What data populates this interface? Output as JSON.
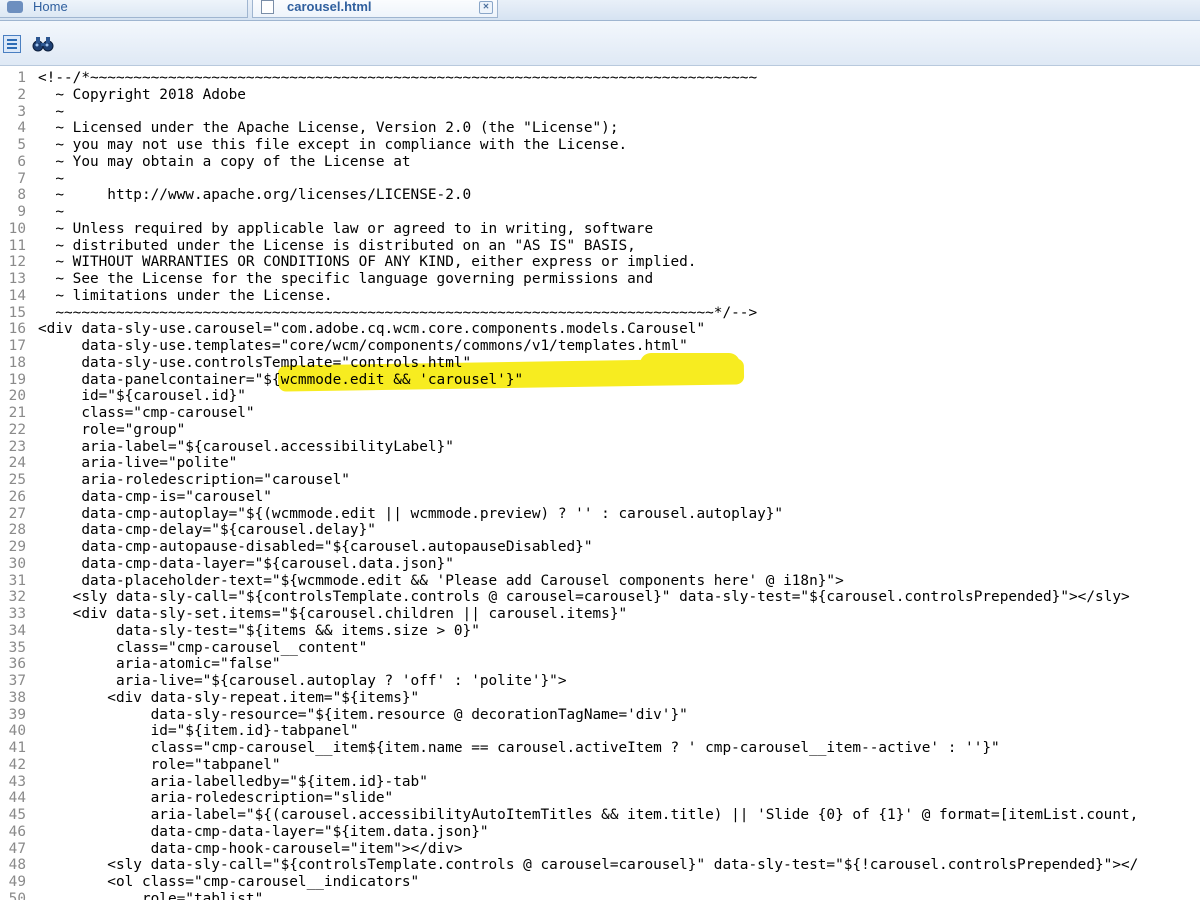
{
  "tabs": [
    {
      "label": "Home",
      "icon": "home-icon"
    },
    {
      "label": "carousel.html",
      "icon": "document-icon"
    }
  ],
  "toolbar": {
    "icons": [
      "outline-icon",
      "find-icon"
    ]
  },
  "highlight_color": "#f7ec20",
  "lines": [
    "<!--/*~~~~~~~~~~~~~~~~~~~~~~~~~~~~~~~~~~~~~~~~~~~~~~~~~~~~~~~~~~~~~~~~~~~~~~~~~~~~~",
    "  ~ Copyright 2018 Adobe",
    "  ~",
    "  ~ Licensed under the Apache License, Version 2.0 (the \"License\");",
    "  ~ you may not use this file except in compliance with the License.",
    "  ~ You may obtain a copy of the License at",
    "  ~",
    "  ~     http://www.apache.org/licenses/LICENSE-2.0",
    "  ~",
    "  ~ Unless required by applicable law or agreed to in writing, software",
    "  ~ distributed under the License is distributed on an \"AS IS\" BASIS,",
    "  ~ WITHOUT WARRANTIES OR CONDITIONS OF ANY KIND, either express or implied.",
    "  ~ See the License for the specific language governing permissions and",
    "  ~ limitations under the License.",
    "  ~~~~~~~~~~~~~~~~~~~~~~~~~~~~~~~~~~~~~~~~~~~~~~~~~~~~~~~~~~~~~~~~~~~~~~~~~~~~*/-->",
    "<div data-sly-use.carousel=\"com.adobe.cq.wcm.core.components.models.Carousel\"",
    "     data-sly-use.templates=\"core/wcm/components/commons/v1/templates.html\"",
    "     data-sly-use.controlsTemplate=\"controls.html\"",
    "     data-panelcontainer=\"${wcmmode.edit && 'carousel'}\"",
    "     id=\"${carousel.id}\"",
    "     class=\"cmp-carousel\"",
    "     role=\"group\"",
    "     aria-label=\"${carousel.accessibilityLabel}\"",
    "     aria-live=\"polite\"",
    "     aria-roledescription=\"carousel\"",
    "     data-cmp-is=\"carousel\"",
    "     data-cmp-autoplay=\"${(wcmmode.edit || wcmmode.preview) ? '' : carousel.autoplay}\"",
    "     data-cmp-delay=\"${carousel.delay}\"",
    "     data-cmp-autopause-disabled=\"${carousel.autopauseDisabled}\"",
    "     data-cmp-data-layer=\"${carousel.data.json}\"",
    "     data-placeholder-text=\"${wcmmode.edit && 'Please add Carousel components here' @ i18n}\">",
    "    <sly data-sly-call=\"${controlsTemplate.controls @ carousel=carousel}\" data-sly-test=\"${carousel.controlsPrepended}\"></sly>",
    "    <div data-sly-set.items=\"${carousel.children || carousel.items}\"",
    "         data-sly-test=\"${items && items.size > 0}\"",
    "         class=\"cmp-carousel__content\"",
    "         aria-atomic=\"false\"",
    "         aria-live=\"${carousel.autoplay ? 'off' : 'polite'}\">",
    "        <div data-sly-repeat.item=\"${items}\"",
    "             data-sly-resource=\"${item.resource @ decorationTagName='div'}\"",
    "             id=\"${item.id}-tabpanel\"",
    "             class=\"cmp-carousel__item${item.name == carousel.activeItem ? ' cmp-carousel__item--active' : ''}\"",
    "             role=\"tabpanel\"",
    "             aria-labelledby=\"${item.id}-tab\"",
    "             aria-roledescription=\"slide\"",
    "             aria-label=\"${(carousel.accessibilityAutoItemTitles && item.title) || 'Slide {0} of {1}' @ format=[itemList.count,",
    "             data-cmp-data-layer=\"${item.data.json}\"",
    "             data-cmp-hook-carousel=\"item\"></div>",
    "        <sly data-sly-call=\"${controlsTemplate.controls @ carousel=carousel}\" data-sly-test=\"${!carousel.controlsPrepended}\"></",
    "        <ol class=\"cmp-carousel__indicators\"",
    "            role=\"tablist\""
  ]
}
